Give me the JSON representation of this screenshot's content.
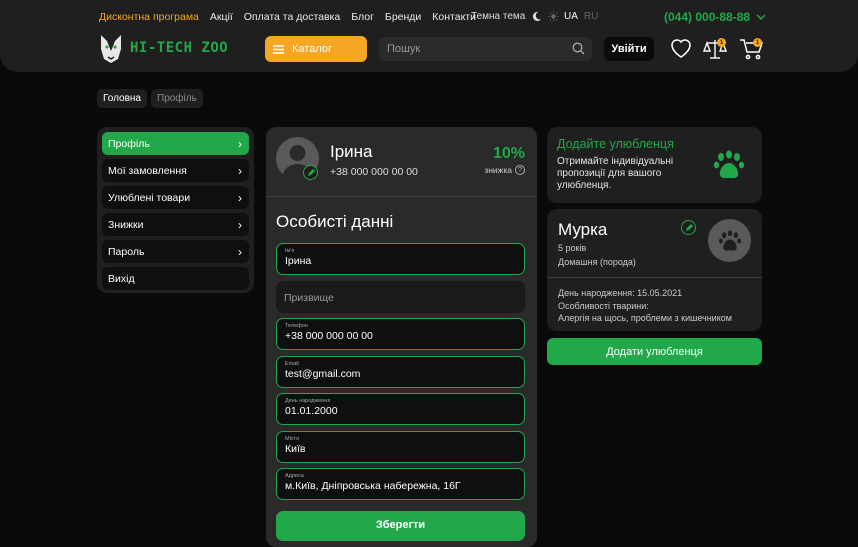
{
  "topnav": {
    "items": [
      "Дисконтна програма",
      "Акції",
      "Оплата та доставка",
      "Блог",
      "Бренди",
      "Контакти"
    ],
    "theme_label": "Темна тема",
    "lang_active": "UA",
    "lang_inactive": "RU",
    "phone": "(044) 000-88-88"
  },
  "header": {
    "logo_text": "HI-TECH ZOO",
    "catalog_label": "Каталог",
    "search_placeholder": "Пошук",
    "login_label": "Увійти",
    "compare_count": "1",
    "cart_count": "1"
  },
  "breadcrumbs": [
    "Головна",
    "Профіль"
  ],
  "sidebar": {
    "items": [
      {
        "label": "Профіль"
      },
      {
        "label": "Мої замовлення"
      },
      {
        "label": "Улюблені товари"
      },
      {
        "label": "Знижки"
      },
      {
        "label": "Пароль"
      },
      {
        "label": "Вихід"
      }
    ]
  },
  "profile": {
    "name": "Ірина",
    "phone": "+38 000 000 00 00",
    "discount": "10%",
    "discount_label": "знижка",
    "section_title": "Особисті данні",
    "fields": [
      {
        "label": "Ім'я",
        "value": "Ірина"
      },
      {
        "label": "",
        "placeholder": "Призвище"
      },
      {
        "label": "Телефон",
        "value": "+38 000 000 00 00"
      },
      {
        "label": "Email",
        "value": "test@gmail.com"
      },
      {
        "label": "День народження",
        "value": "01.01.2000"
      },
      {
        "label": "Місто",
        "value": "Київ"
      },
      {
        "label": "Адреса",
        "value": "м.Київ, Дніпровська набережна, 16Г"
      }
    ],
    "save_label": "Зберегти"
  },
  "add_pet": {
    "title": "Додайте улюбленця",
    "description": "Отримайте індивідуальні пропозиції  для вашого улюбленця."
  },
  "pet": {
    "name": "Мурка",
    "age": "5 років",
    "breed": "Домашня (порода)",
    "birthday": "День народження: 15.05.2021",
    "features_label": "Особливості тварини:",
    "features": "Алергія на щось, проблеми з кишечником"
  },
  "add_pet_button": "Додати улюбленця",
  "colors": {
    "accent": "#22a84b",
    "orange": "#f5a623",
    "panel": "#1f1f1f"
  }
}
